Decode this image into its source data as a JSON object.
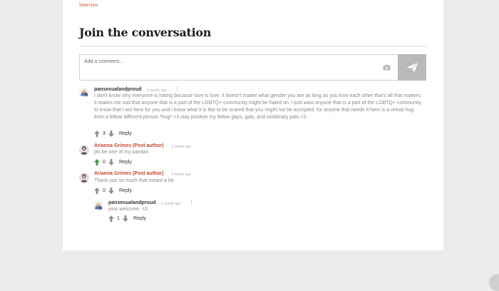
{
  "article": {
    "kicker": "Interview",
    "heading": "Join the conversation"
  },
  "comment_form": {
    "placeholder": "Add a comment...",
    "camera_icon": "camera-icon",
    "send_icon": "send-icon"
  },
  "comments": [
    {
      "author": "pansexualandproud",
      "time": "1 month ago",
      "text": "I don't know why everyone is hating because love is love. it doesn't matter what gender you are as long as you love each other that's all that matters. it makes me sad that anyone that is a part of the LGBTQ+ community might be hated on. I just want anyone that is a part of the LGBTQ+ community to know that I am here for you and I know what it is like to be scared that you might not be accepted. for anyone that needs it here is a virtual hug from a fellow different person *hug* <3 stay positive my fellow gays, gals, and nonbinary pals <3",
      "votes": "3",
      "reply_label": "Reply"
    },
    {
      "author": "Arianna Grimes (Post author)",
      "time": "1 month ago",
      "text": "pls be one of my pandas",
      "votes": "0",
      "reply_label": "Reply"
    },
    {
      "author": "Arianna Grimes (Post author)",
      "time": "1 month ago",
      "text": "Thank you so much that meant a lot",
      "votes": "0",
      "reply_label": "Reply"
    },
    {
      "author": "pansexualandproud",
      "time": "1 month ago",
      "text": "your welcome. <3",
      "votes": "1",
      "reply_label": "Reply"
    }
  ],
  "colors": {
    "accent": "#c8462a",
    "upvote_active": "#3a9b3a",
    "send_bg": "#b9b9b9"
  }
}
